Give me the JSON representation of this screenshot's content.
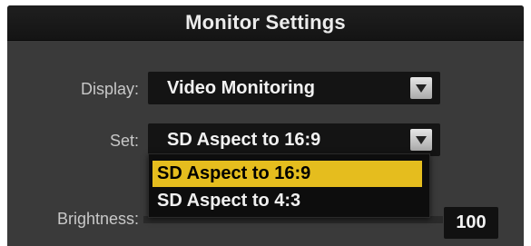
{
  "window": {
    "title": "Monitor Settings"
  },
  "display": {
    "label": "Display:",
    "value": "Video Monitoring"
  },
  "set": {
    "label": "Set:",
    "value": "SD Aspect to 16:9",
    "options": [
      "SD Aspect to 16:9",
      "SD Aspect to 4:3"
    ],
    "highlighted_index": 0
  },
  "brightness": {
    "label": "Brightness:",
    "value": "100"
  },
  "colors": {
    "highlight": "#e5bd1e",
    "panel": "#3a3a3a",
    "titlebar": "#141414"
  },
  "icons": {
    "dropdown_arrow": "chevron-down-icon"
  }
}
